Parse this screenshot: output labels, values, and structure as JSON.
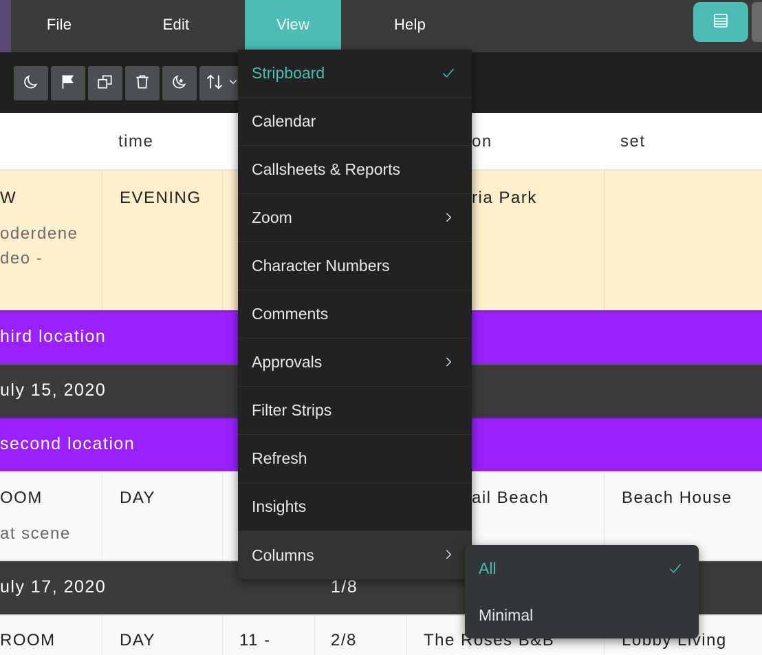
{
  "menubar": {
    "items": [
      {
        "label": "File"
      },
      {
        "label": "Edit"
      },
      {
        "label": "View"
      },
      {
        "label": "Help"
      }
    ],
    "active": "View",
    "toggle_icon": "stripboard-layout-icon"
  },
  "toolbar": {
    "buttons": [
      {
        "icon": "moon-icon"
      },
      {
        "icon": "flag-icon"
      },
      {
        "icon": "duplicate-icon"
      },
      {
        "icon": "trash-icon"
      },
      {
        "icon": "moon-star-icon"
      },
      {
        "icon": "sort-icon"
      }
    ]
  },
  "table": {
    "headers": {
      "time": "time",
      "location": "on",
      "set": "set"
    },
    "rows": [
      {
        "type": "strip",
        "name": "W",
        "time": "EVENING",
        "location": "ria Park",
        "set": "",
        "desc1": "oderdene",
        "desc2": "deo -"
      },
      {
        "type": "banner",
        "text": "hird location"
      },
      {
        "type": "day",
        "text": "uly 15, 2020"
      },
      {
        "type": "banner",
        "text": "second location"
      },
      {
        "type": "strip",
        "name": "OOM",
        "time": "DAY",
        "location": "ail Beach",
        "set": "Beach House",
        "desc1": "at scene"
      },
      {
        "type": "day",
        "text": "uly 17, 2020",
        "pages": "1/8"
      },
      {
        "type": "strip",
        "name": "ROOM",
        "time": "DAY",
        "num": "11 -",
        "pages": "2/8",
        "location": "The Roses B&B",
        "set": "Lobby Living"
      }
    ]
  },
  "view_menu": {
    "items": [
      {
        "label": "Stripboard",
        "checked": true
      },
      {
        "label": "Calendar"
      },
      {
        "label": "Callsheets & Reports"
      },
      {
        "label": "Zoom",
        "submenu": true
      },
      {
        "label": "Character Numbers"
      },
      {
        "label": "Comments"
      },
      {
        "label": "Approvals",
        "submenu": true
      },
      {
        "label": "Filter Strips"
      },
      {
        "label": "Refresh"
      },
      {
        "label": "Insights"
      },
      {
        "label": "Columns",
        "submenu": true,
        "hover": true
      }
    ]
  },
  "columns_submenu": {
    "items": [
      {
        "label": "All",
        "checked": true
      },
      {
        "label": "Minimal"
      }
    ]
  },
  "colors": {
    "accent": "#4abcb3",
    "banner_purple": "#9a21fb",
    "strip_yellow": "#fdefcc",
    "day_header": "#3b3b3b",
    "menu_bg": "#222222"
  }
}
